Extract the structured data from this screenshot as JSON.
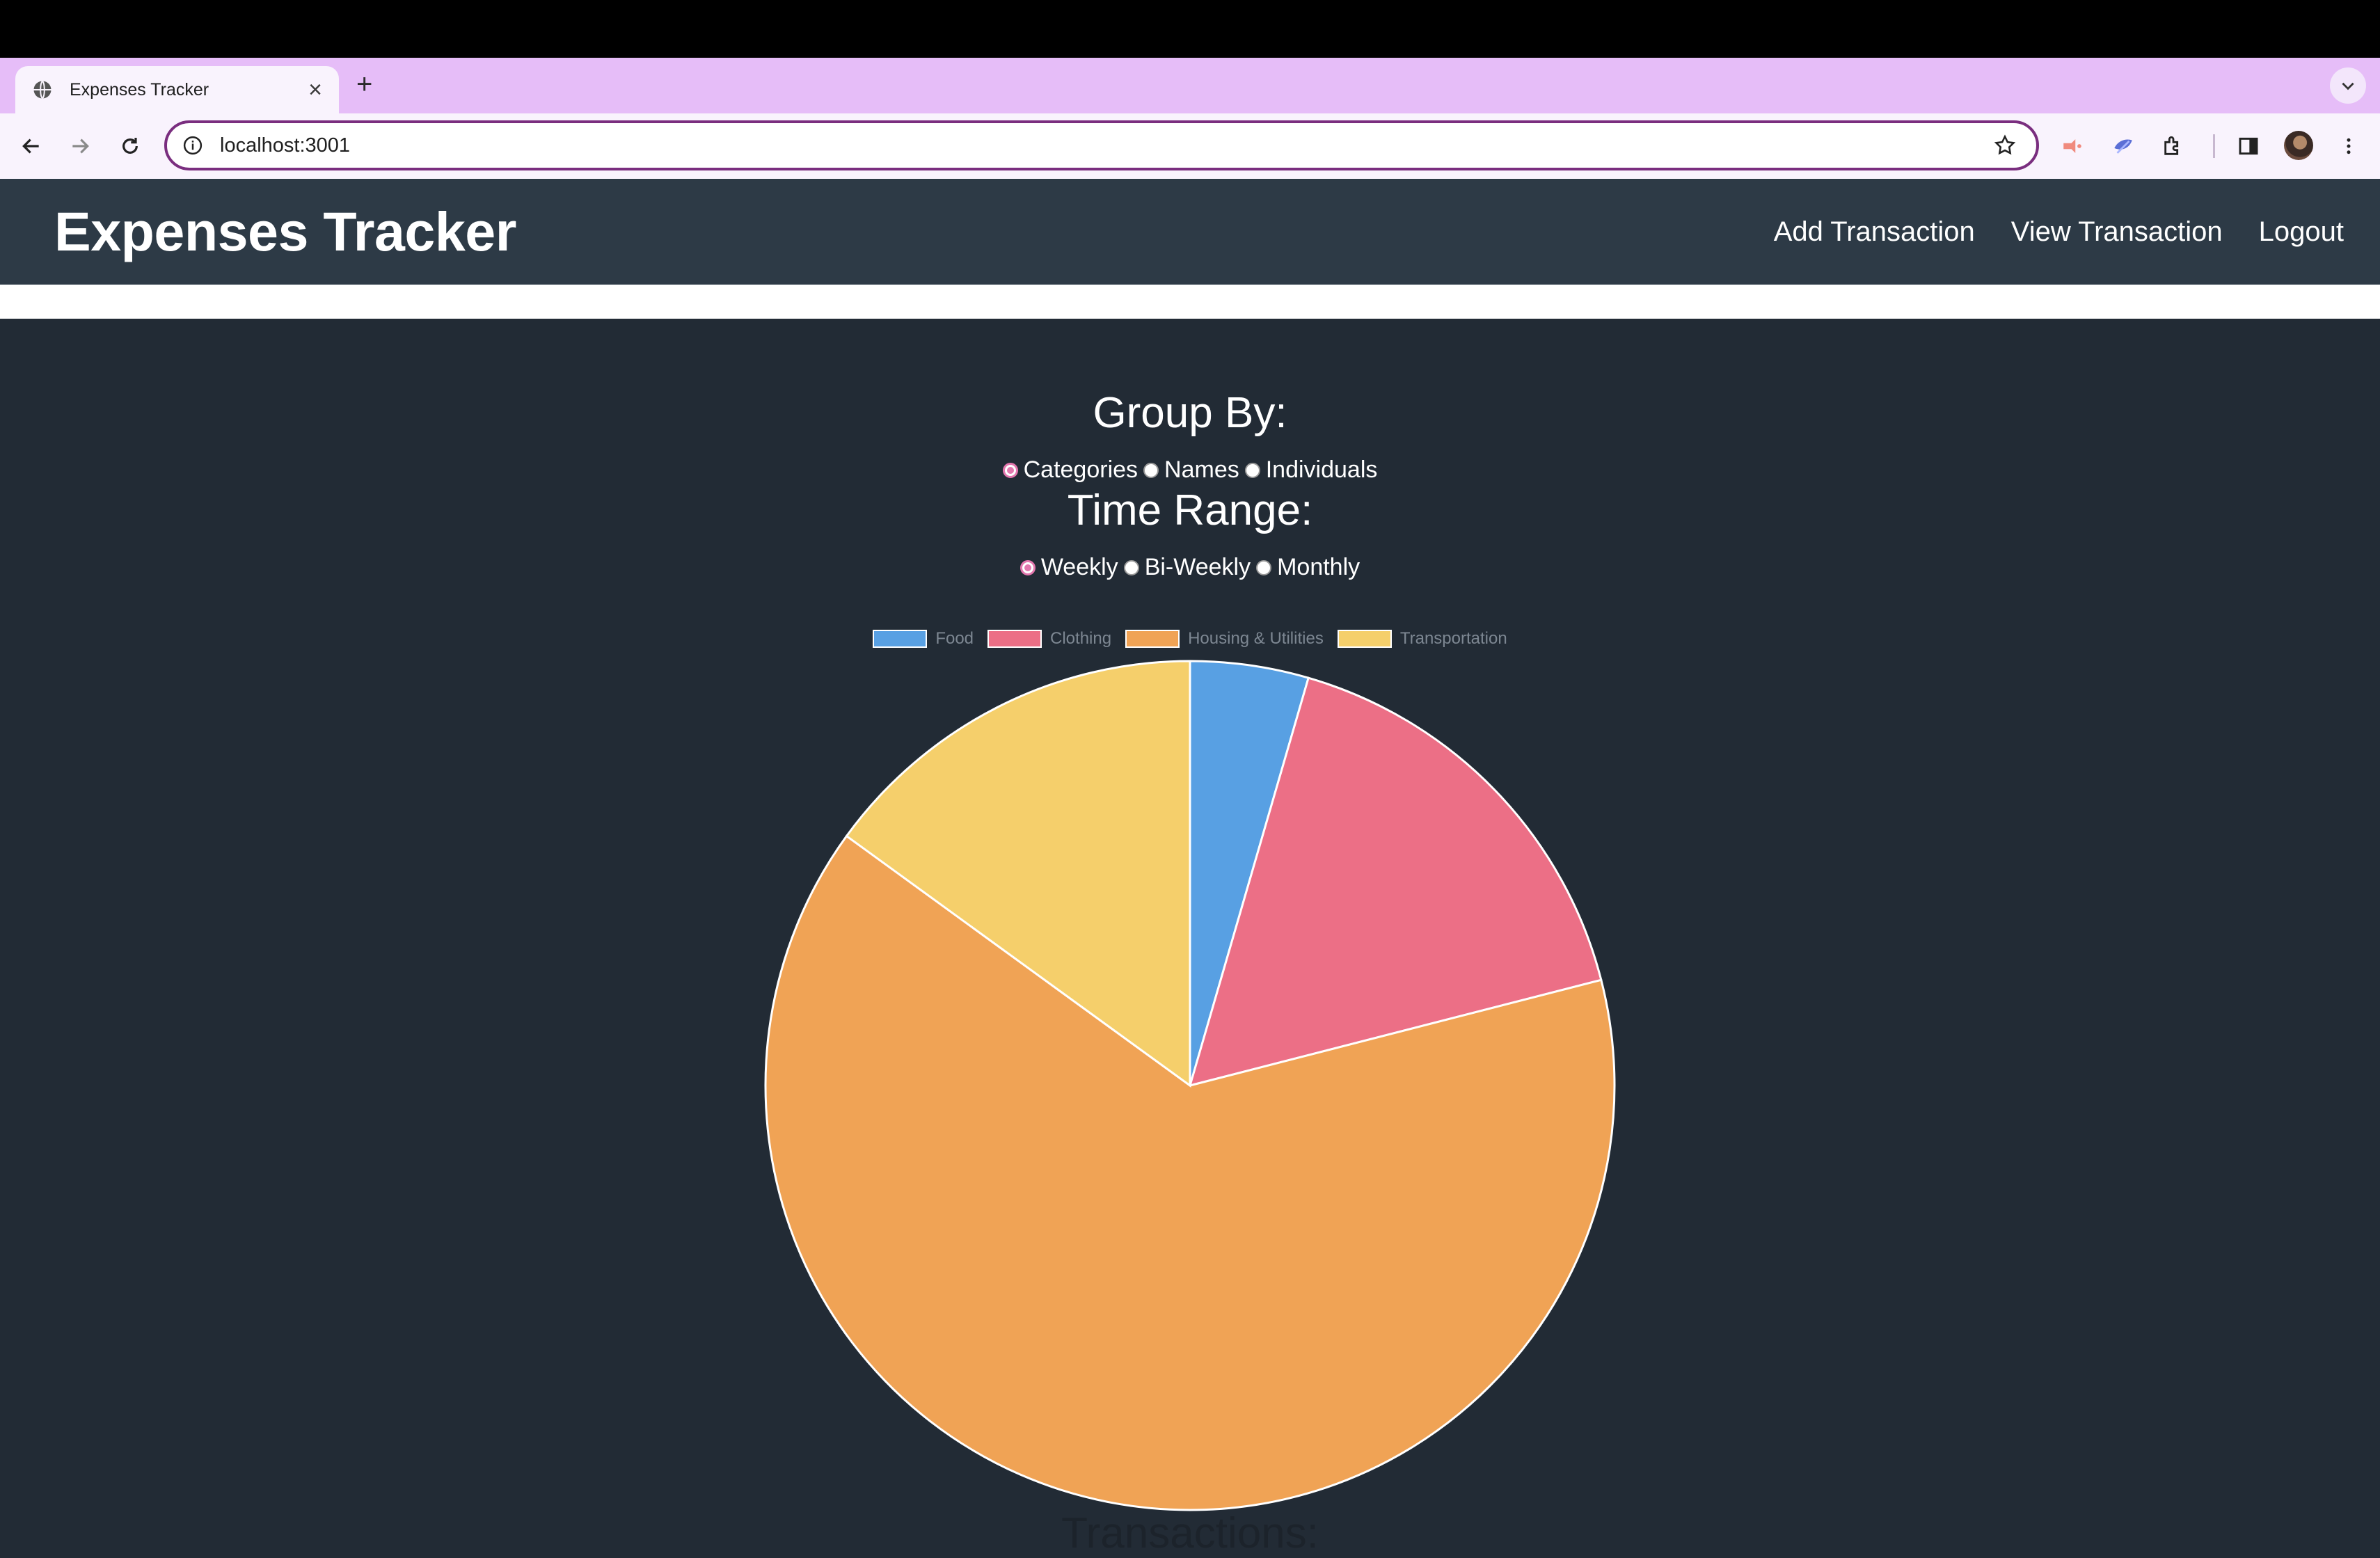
{
  "browser": {
    "tab_title": "Expenses Tracker",
    "url": "localhost:3001"
  },
  "app": {
    "brand": "Expenses Tracker",
    "nav": [
      "Add Transaction",
      "View Transaction",
      "Logout"
    ]
  },
  "controls": {
    "group_by_label": "Group By:",
    "group_by_options": [
      "Categories",
      "Names",
      "Individuals"
    ],
    "group_by_selected": "Categories",
    "time_range_label": "Time Range:",
    "time_range_options": [
      "Weekly",
      "Bi-Weekly",
      "Monthly"
    ],
    "time_range_selected": "Weekly"
  },
  "chart_data": {
    "type": "pie",
    "categories": [
      "Food",
      "Clothing",
      "Housing & Utilities",
      "Transportation"
    ],
    "values": [
      4.5,
      16.5,
      64,
      15
    ],
    "colors": [
      "#58a0e3",
      "#ec6f86",
      "#f0a355",
      "#f5cf6b"
    ],
    "legend_position": "top"
  },
  "footer_heading": "Transactions:"
}
